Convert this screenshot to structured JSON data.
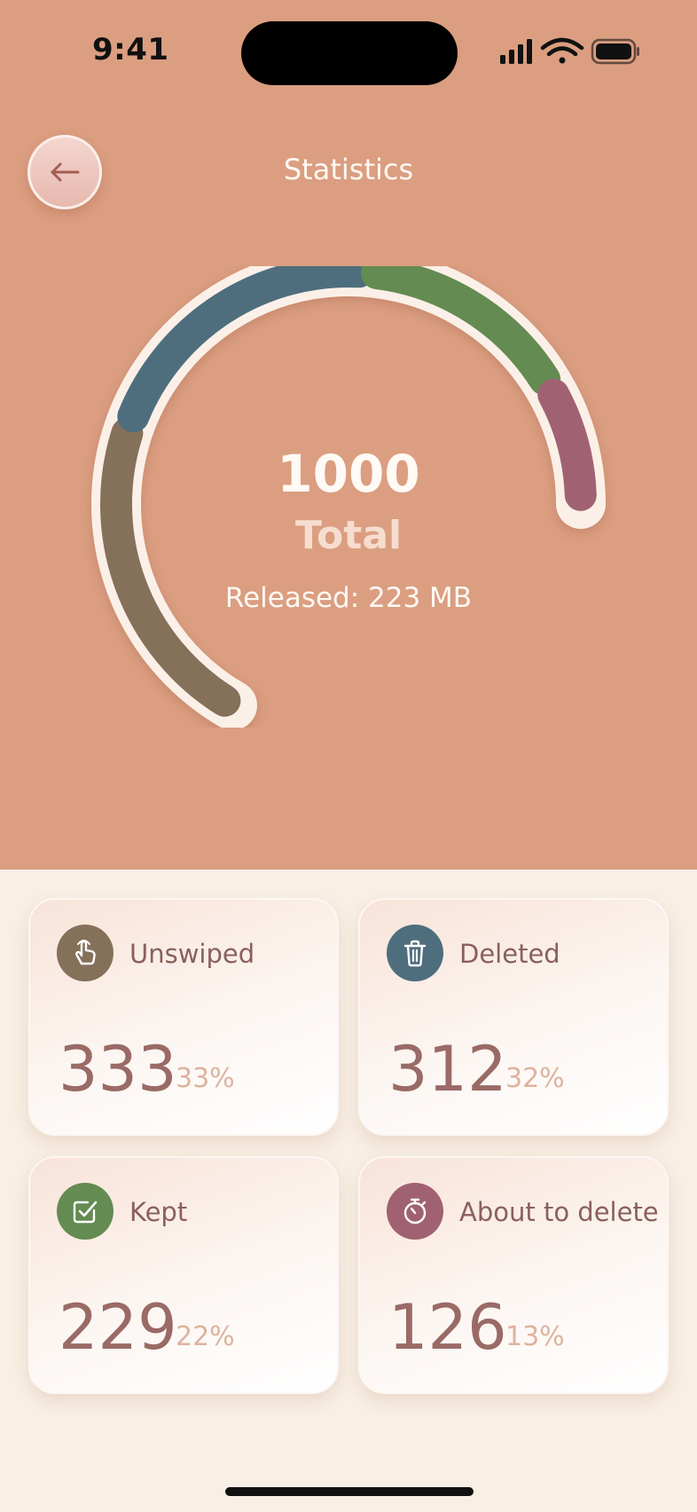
{
  "status_bar": {
    "time": "9:41"
  },
  "header": {
    "title": "Statistics",
    "back_icon": "arrow-left-icon"
  },
  "summary": {
    "total": "1000",
    "total_label": "Total",
    "released_label": "Released:",
    "released_value": "223 MB"
  },
  "gauge": {
    "segments": [
      {
        "name": "Unswiped",
        "fraction": 0.333,
        "color": "#85705a"
      },
      {
        "name": "Deleted",
        "fraction": 0.312,
        "color": "#4e6e7e"
      },
      {
        "name": "Kept",
        "fraction": 0.229,
        "color": "#648b52"
      },
      {
        "name": "About to delete",
        "fraction": 0.126,
        "color": "#a06272"
      }
    ]
  },
  "cards": [
    {
      "label": "Unswiped",
      "value": "333",
      "percent": "33%",
      "icon": "hand-swipe-icon",
      "color": "#85705a"
    },
    {
      "label": "Deleted",
      "value": "312",
      "percent": "32%",
      "icon": "trash-icon",
      "color": "#4e6e7e"
    },
    {
      "label": "Kept",
      "value": "229",
      "percent": "22%",
      "icon": "check-square-icon",
      "color": "#648b52"
    },
    {
      "label": "About to delete",
      "value": "126",
      "percent": "13%",
      "icon": "timer-icon",
      "color": "#a06272"
    }
  ]
}
